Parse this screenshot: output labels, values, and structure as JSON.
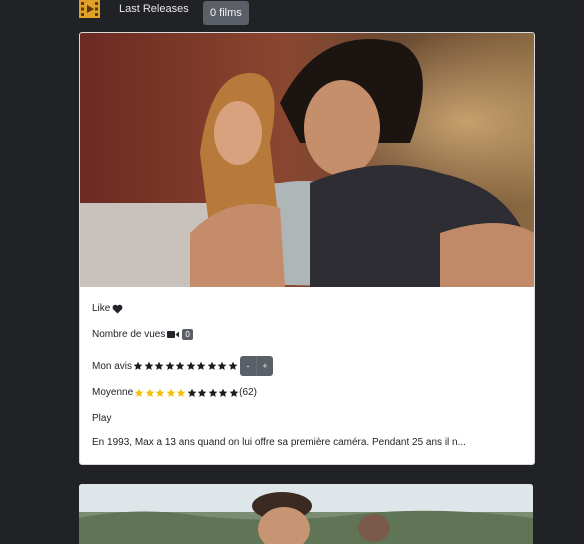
{
  "nav": {
    "link_label": "Last Releases",
    "count_label": "0 films"
  },
  "colors": {
    "background": "#212225",
    "badge": "#5b6068",
    "star_gold": "#f2c10f",
    "star_dark": "#1c1c1c"
  },
  "movie": {
    "like_label": "Like",
    "views_label": "Nombre de vues",
    "views_count": "0",
    "my_review_label": "Mon avis",
    "my_review_stars": {
      "filled": 0,
      "total": 10
    },
    "minus_label": "-",
    "plus_label": "+",
    "average_label": "Moyenne",
    "average_stars": {
      "filled": 5,
      "total": 10
    },
    "average_count": "(62)",
    "play_label": "Play",
    "synopsis": "En 1993, Max a 13 ans quand on lui offre sa première caméra. Pendant 25 ans il n..."
  },
  "icons": {
    "logo": "film-clapper-icon",
    "like": "heart-icon",
    "views": "video-camera-icon",
    "star": "star-icon"
  }
}
